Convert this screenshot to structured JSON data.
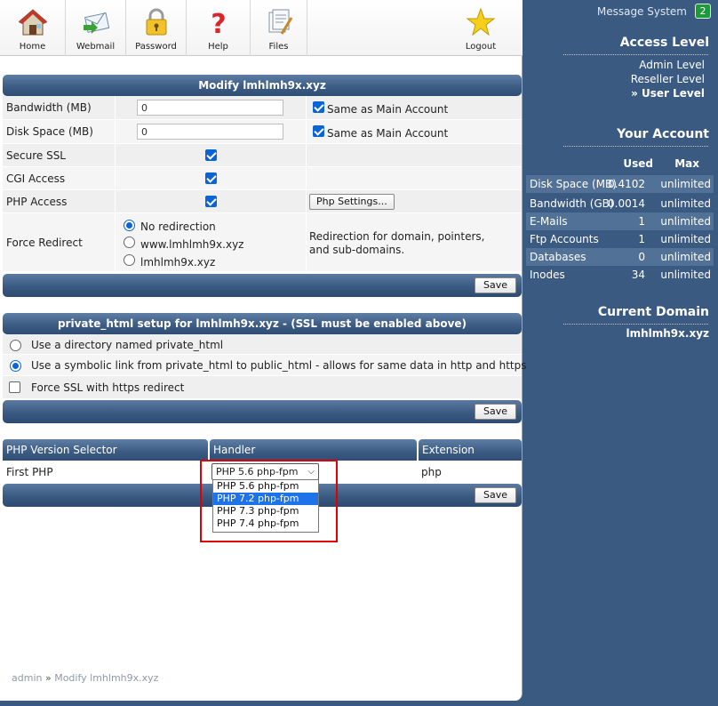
{
  "nav": {
    "home": "Home",
    "webmail": "Webmail",
    "password": "Password",
    "help": "Help",
    "files": "Files",
    "logout": "Logout"
  },
  "modify": {
    "title": "Modify lmhlmh9x.xyz",
    "rows": {
      "bandwidth_label": "Bandwidth (MB)",
      "bandwidth_value": "0",
      "bandwidth_same": "Same as Main Account",
      "disk_label": "Disk Space (MB)",
      "disk_value": "0",
      "disk_same": "Same as Main Account",
      "ssl_label": "Secure SSL",
      "cgi_label": "CGI Access",
      "php_label": "PHP Access",
      "php_settings": "Php Settings...",
      "redirect_label": "Force Redirect",
      "redirect_opt1": "No redirection",
      "redirect_opt2": "www.lmhlmh9x.xyz",
      "redirect_opt3": "lmhlmh9x.xyz",
      "redirect_note1": "Redirection for domain, pointers,",
      "redirect_note2": "and sub-domains."
    },
    "save": "Save"
  },
  "private_html": {
    "title": "private_html setup for lmhlmh9x.xyz - (SSL must be enabled above)",
    "opt1": "Use a directory named private_html",
    "opt2": "Use a symbolic link from private_html to public_html - allows for same data in http and https",
    "opt3": "Force SSL with https redirect",
    "save": "Save"
  },
  "php_version": {
    "headers": [
      "PHP Version Selector",
      "Handler",
      "Extension"
    ],
    "row_label": "First PHP",
    "selected": "PHP 5.6 php-fpm",
    "extension": "php",
    "options": [
      "PHP 5.6 php-fpm",
      "PHP 7.2 php-fpm",
      "PHP 7.3 php-fpm",
      "PHP 7.4 php-fpm"
    ],
    "highlighted_option": "PHP 7.2 php-fpm",
    "save": "Save"
  },
  "breadcrumb": {
    "root": "admin",
    "sep": "»",
    "current": "Modify lmhlmh9x.xyz"
  },
  "sidebar": {
    "message_system": "Message System",
    "message_count": "2",
    "access_level_title": "Access Level",
    "levels": [
      "Admin Level",
      "Reseller Level",
      "» User Level"
    ],
    "your_account_title": "Your Account",
    "col_used": "Used",
    "col_max": "Max",
    "account_rows": [
      {
        "label": "Disk Space (MB)",
        "used": "0.4102",
        "max": "unlimited"
      },
      {
        "label": "Bandwidth (GB)",
        "used": "0.0014",
        "max": "unlimited"
      },
      {
        "label": "E-Mails",
        "used": "1",
        "max": "unlimited"
      },
      {
        "label": "Ftp Accounts",
        "used": "1",
        "max": "unlimited"
      },
      {
        "label": "Databases",
        "used": "0",
        "max": "unlimited"
      },
      {
        "label": "Inodes",
        "used": "34",
        "max": "unlimited"
      }
    ],
    "current_domain_title": "Current Domain",
    "current_domain": "lmhlmh9x.xyz"
  },
  "colors": {
    "accent_blue": "#3b5a82",
    "highlight": "#1e73e8",
    "annotation_red": "#e00000",
    "badge_green": "#1f9a3a"
  }
}
